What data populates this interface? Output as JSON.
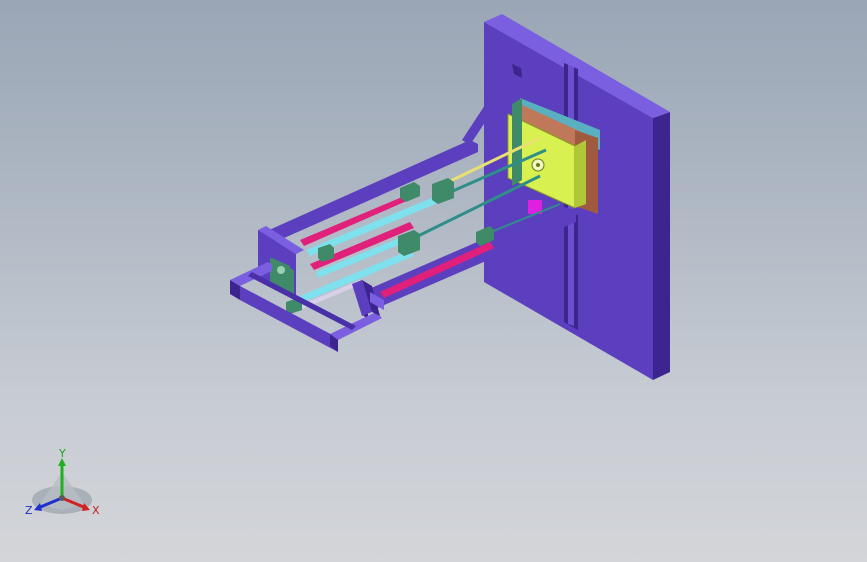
{
  "viewport": {
    "background_top": "#9aa6b6",
    "background_bottom": "#d3d5d9"
  },
  "model": {
    "colors": {
      "frame": "#5b3fbf",
      "frame_dark": "#3d2590",
      "frame_light": "#7a5fe0",
      "rail_pink": "#e0207a",
      "rail_cyan": "#7fe0ee",
      "rod_teal": "#2f8f88",
      "rod_yellow": "#e8e070",
      "carriage_green": "#3f8a68",
      "block_yellow": "#d8f050",
      "plates_brown": "#c0785a",
      "accent_magenta": "#e020e0"
    }
  },
  "triad": {
    "x_label": "X",
    "y_label": "Y",
    "z_label": "Z",
    "x_color": "#d42020",
    "y_color": "#20b020",
    "z_color": "#2030d0"
  }
}
